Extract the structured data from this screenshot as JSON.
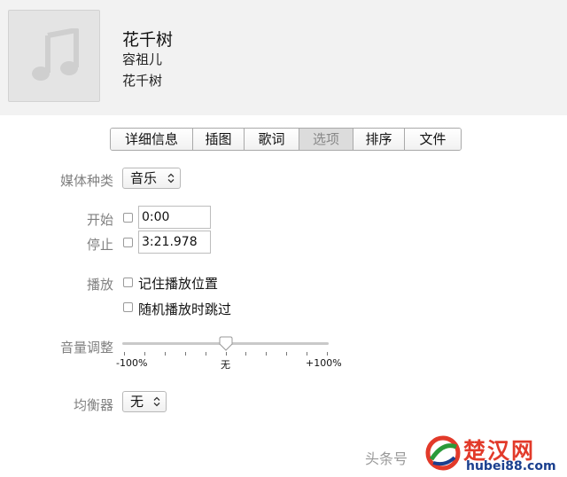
{
  "song": {
    "title": "花千树",
    "artist": "容祖儿",
    "album": "花千树"
  },
  "artwork": {
    "icon": "music-note-icon"
  },
  "tabs": [
    {
      "label": "详细信息",
      "active": false
    },
    {
      "label": "插图",
      "active": false
    },
    {
      "label": "歌词",
      "active": false
    },
    {
      "label": "选项",
      "active": true
    },
    {
      "label": "排序",
      "active": false
    },
    {
      "label": "文件",
      "active": false
    }
  ],
  "options": {
    "media_kind": {
      "label": "媒体种类",
      "value": "音乐"
    },
    "start": {
      "label": "开始",
      "value": "0:00",
      "checked": false
    },
    "stop": {
      "label": "停止",
      "value": "3:21.978",
      "checked": false
    },
    "playback": {
      "label": "播放",
      "remember_position": {
        "label": "记住播放位置",
        "checked": false
      },
      "skip_shuffle": {
        "label": "随机播放时跳过",
        "checked": false
      }
    },
    "volume": {
      "label": "音量调整",
      "min_label": "-100%",
      "mid_label": "无",
      "max_label": "+100%",
      "value_percent": 0
    },
    "equalizer": {
      "label": "均衡器",
      "value": "无"
    }
  },
  "watermark": {
    "text": "头条号",
    "brand_name": "楚汉网",
    "brand_url": "hubei88.com"
  },
  "colors": {
    "accent_red": "#e23a2a",
    "accent_blue": "#1a3f8e",
    "label_gray": "#808080"
  }
}
